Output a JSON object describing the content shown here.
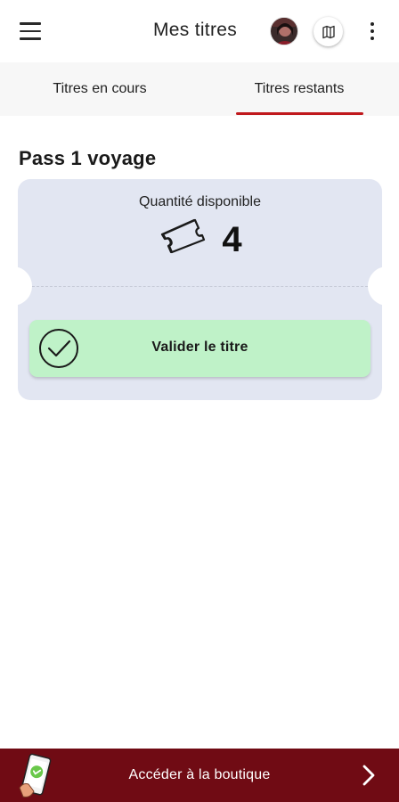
{
  "appbar": {
    "title": "Mes titres",
    "menu_icon": "hamburger-menu-icon",
    "map_icon": "map-icon",
    "more_icon": "vertical-dots-icon"
  },
  "tabs": [
    {
      "label": "Titres en cours",
      "selected": false
    },
    {
      "label": "Titres restants",
      "selected": true
    }
  ],
  "section": {
    "title": "Pass 1 voyage"
  },
  "ticket": {
    "quantity_label": "Quantité disponible",
    "quantity_value": "4",
    "ticket_icon": "ticket-icon",
    "validate_label": "Valider le titre",
    "validate_icon": "check-circle-icon"
  },
  "shop": {
    "label": "Accéder à la boutique",
    "icon": "phone-shop-icon",
    "chevron_icon": "chevron-right-icon"
  },
  "colors": {
    "accent_red": "#c0191d",
    "shop_bar": "#700b14",
    "ticket_bg": "#e2e6f2",
    "validate_bg": "#bff2c8"
  }
}
